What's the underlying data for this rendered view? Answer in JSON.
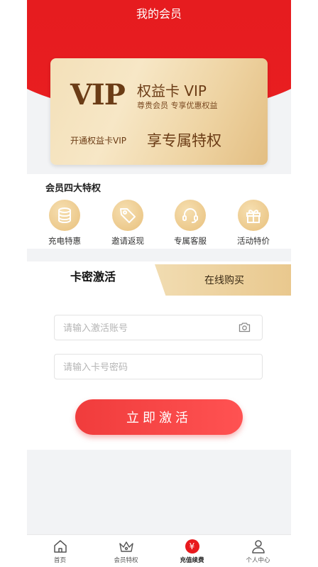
{
  "header": {
    "title": "我的会员"
  },
  "card": {
    "logo": "VIP",
    "name": "权益卡 VIP",
    "subtitle": "尊贵会员  专享优惠权益",
    "open_text": "开通权益卡VIP",
    "privilege": "享专属特权"
  },
  "perks": {
    "title": "会员四大特权",
    "items": [
      {
        "label": "充电特惠",
        "icon": "coins-icon"
      },
      {
        "label": "邀请返现",
        "icon": "tag-icon"
      },
      {
        "label": "专属客服",
        "icon": "headset-icon"
      },
      {
        "label": "活动特价",
        "icon": "gift-icon"
      }
    ]
  },
  "activation": {
    "tab_active": "卡密激活",
    "tab_buy": "在线购买",
    "account_placeholder": "请输入激活账号",
    "password_placeholder": "请输入卡号密码",
    "button": "立即激活"
  },
  "tabbar": {
    "items": [
      {
        "label": "首页",
        "icon": "home-icon"
      },
      {
        "label": "会员特权",
        "icon": "crown-icon"
      },
      {
        "label": "充值续费",
        "icon": "yen-icon",
        "active": true,
        "glyph": "¥"
      },
      {
        "label": "个人中心",
        "icon": "user-icon"
      }
    ]
  },
  "colors": {
    "brand_red": "#e3171b",
    "gold": "#e8c07c",
    "button_red": "#f03c3c"
  }
}
